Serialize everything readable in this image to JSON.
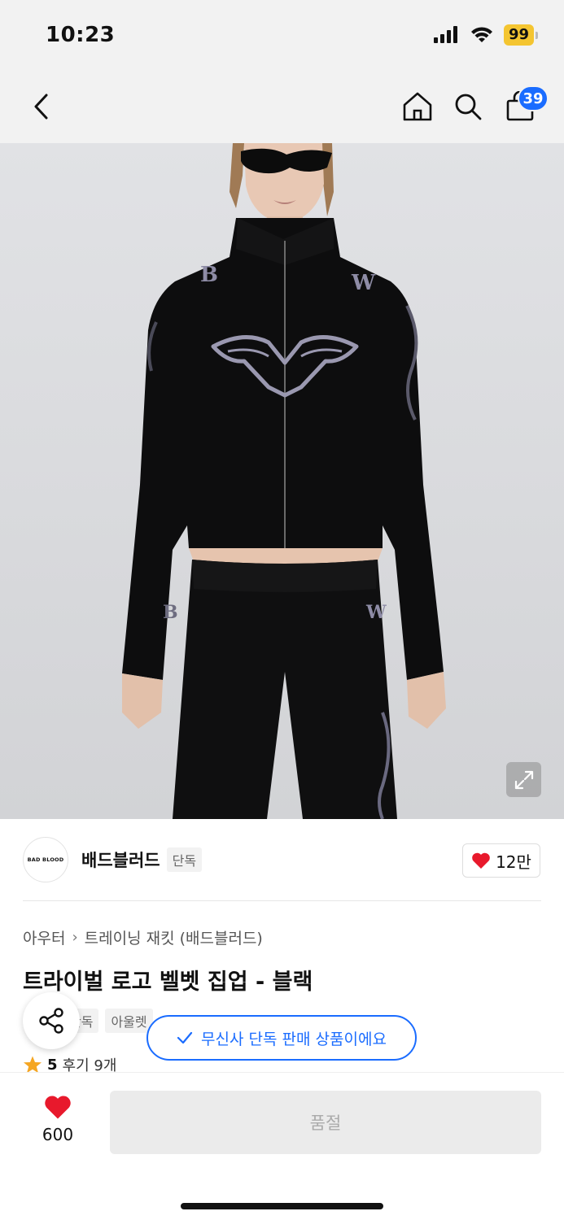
{
  "status_bar": {
    "time": "10:23",
    "battery": "99",
    "icons": [
      "signal-icon",
      "wifi-icon",
      "battery-icon"
    ]
  },
  "header": {
    "back_icon": "chevron-left-icon",
    "home_icon": "home-icon",
    "search_icon": "search-icon",
    "cart_icon": "shopping-bag-icon",
    "cart_count": "39"
  },
  "product_image": {
    "expand_icon": "expand-icon"
  },
  "brand": {
    "logo_text": "BAD BLOOD",
    "name": "배드블러드",
    "tag": "단독",
    "like_icon": "heart-icon",
    "like_count": "12만"
  },
  "category": {
    "level1": "아우터",
    "level2": "트레이닝 재킷 (배드블러드)"
  },
  "product": {
    "title": "트라이벌 로고 벨벳 집업 - 블랙",
    "tags": [
      "단독",
      "아울렛"
    ],
    "rating": "5",
    "reviews": "후기 9개"
  },
  "exclusive_notice": "무신사 단독 판매 상품이에요",
  "bottom_bar": {
    "like_count": "600",
    "soldout_label": "품절"
  },
  "colors": {
    "accent": "#1a6cff",
    "heart": "#e8192c",
    "star": "#f5a623",
    "battery": "#f4c531"
  }
}
